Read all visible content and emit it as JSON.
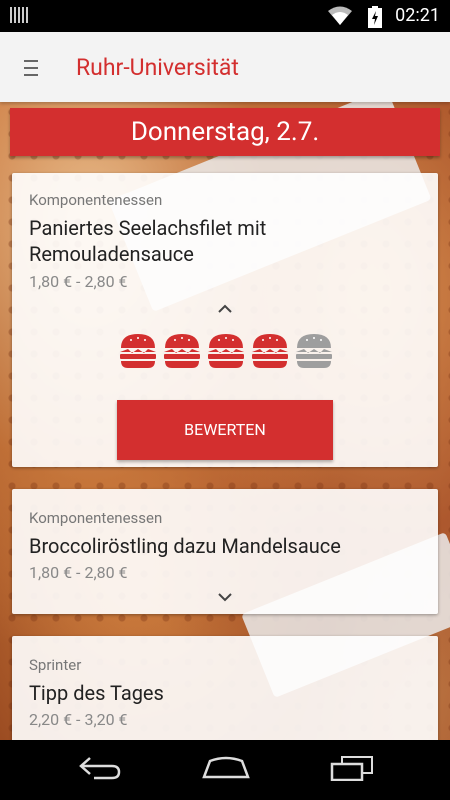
{
  "status_bar": {
    "time": "02:21"
  },
  "app_bar": {
    "title": "Ruhr-Universität"
  },
  "date_banner": {
    "label": "Donnerstag, 2.7."
  },
  "meals": [
    {
      "category": "Komponentenessen",
      "name_line1": "Paniertes Seelachsfilet mit",
      "name_line2": "Remouladensauce",
      "price": "1,80 € - 2,80 €",
      "expanded": true,
      "rating": {
        "value": 4,
        "max": 5
      },
      "rate_button": "BEWERTEN"
    },
    {
      "category": "Komponentenessen",
      "name_line1": "Broccoliröstling dazu Mandelsauce",
      "price": "1,80 € - 2,80 €",
      "expanded": false
    },
    {
      "category": "Sprinter",
      "name_line1": "Tipp des Tages",
      "price": "2,20 € - 3,20 €",
      "expanded": false
    }
  ],
  "colors": {
    "accent": "#d32f2f",
    "burger_active": "#d32f2f",
    "burger_inactive": "#9e9e9e"
  }
}
